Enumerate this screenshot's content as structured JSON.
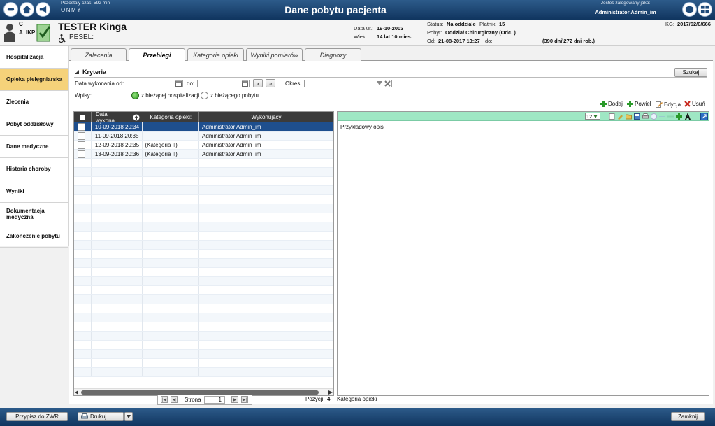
{
  "topbar": {
    "remaining_time": "Pozostały czas: 592 min",
    "logo": "ONMY",
    "title": "Dane pobytu pacjenta",
    "logged_label": "Jesteś zalogowany jako:",
    "logged_user": "Administrator Admin_im",
    "icons": [
      "power-icon",
      "home-icon",
      "megaphone-icon",
      "cube-icon",
      "grid-icon"
    ]
  },
  "patient": {
    "flag_c": "C",
    "flag_a": "A",
    "flag_ikp": "IKP",
    "name": "TESTER Kinga",
    "pesel_label": "PESEL:",
    "birth_label": "Data ur.:",
    "birth": "19-10-2003",
    "age_label": "Wiek:",
    "age": "14 lat 10 mies.",
    "status_label": "Status:",
    "status": "Na oddziale",
    "payer_label": "Płatnik:",
    "payer": "15",
    "stay_label": "Pobyt:",
    "stay": "Oddział Chirurgiczny (Odc. )",
    "from_label": "Od:",
    "from": "21-08-2017   13:27",
    "to_label": "do:",
    "days": "(390 dni\\272 dni rob.)",
    "kg_label": "KG:",
    "kg": "2017/62/0/666"
  },
  "sidebar": {
    "items": [
      {
        "label": "Hospitalizacja"
      },
      {
        "label": "Opieka pielęgniarska"
      },
      {
        "label": "Zlecenia"
      },
      {
        "label": "Pobyt oddziałowy"
      },
      {
        "label": "Dane medyczne"
      },
      {
        "label": "Historia choroby"
      },
      {
        "label": "Wyniki"
      },
      {
        "label": "Dokumentacja medyczna"
      },
      {
        "label": "Zakończenie pobytu"
      }
    ]
  },
  "tabs": [
    {
      "label": "Zalecenia"
    },
    {
      "label": "Przebiegi"
    },
    {
      "label": "Kategoria opieki"
    },
    {
      "label": "Wyniki pomiarów"
    },
    {
      "label": "Diagnozy"
    }
  ],
  "criteria": {
    "title": "Kryteria",
    "search": "Szukaj",
    "date_from_label": "Data wykonania od:",
    "date_to_label": "do:",
    "period_label": "Okres:",
    "entries_label": "Wpisy:",
    "radio1": "z bieżącej hospitalizacji",
    "radio2": "z bieżącego pobytu"
  },
  "toolbar": {
    "add": "Dodaj",
    "repeat": "Powiel",
    "edit": "Edycja",
    "delete": "Usuń"
  },
  "table": {
    "columns": [
      "Data wykona...",
      "Kategoria opieki:",
      "Wykonujący"
    ],
    "rows": [
      {
        "date": "10-09-2018  20:34",
        "category": "",
        "performer": "Administrator Admin_im"
      },
      {
        "date": "11-09-2018  20:35",
        "category": "",
        "performer": "Administrator Admin_im"
      },
      {
        "date": "12-09-2018  20:35",
        "category": "(Kategoria II)",
        "performer": "Administrator Admin_im"
      },
      {
        "date": "13-09-2018  20:36",
        "category": "(Kategoria II)",
        "performer": "Administrator Admin_im"
      }
    ]
  },
  "editor": {
    "font_size": "12",
    "text": "Przykładowy opis"
  },
  "pager": {
    "page_label": "Strona",
    "page": "1",
    "positions_label": "Pozycji:",
    "positions": "4",
    "footer_label": "Kategoria opieki"
  },
  "bottom": {
    "assign": "Przypisz do ZWR",
    "print": "Drukuj",
    "close": "Zamknij"
  }
}
